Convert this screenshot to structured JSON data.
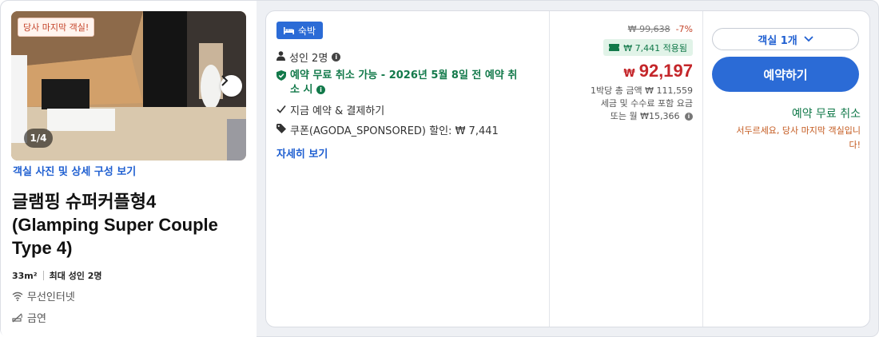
{
  "room": {
    "photo": {
      "last_room_tag": "당사 마지막 객실!",
      "counter": "1/4"
    },
    "photo_link": "객실 사진 및 상세 구성 보기",
    "title_lines": [
      "글램핑 슈퍼커플형4",
      "(Glamping Super Couple",
      "Type 4)"
    ],
    "size": "33m²",
    "max_occupancy": "최대 성인 2명",
    "amenities": [
      {
        "icon": "wifi-icon",
        "label": "무선인터넷"
      },
      {
        "icon": "no-smoking-icon",
        "label": "금연"
      }
    ]
  },
  "offer": {
    "badge": "숙박",
    "guests": "성인 2명",
    "free_cancel_line1": "예약 무료 취소 가능 - 2026년 5월 8일 전 예약 취",
    "free_cancel_line2": "소 시",
    "pay_now": "지금 예약 & 결제하기",
    "coupon": "쿠폰(AGODA_SPONSORED) 할인: ₩ 7,441",
    "more_link": "자세히 보기"
  },
  "price": {
    "original": "₩ 99,638",
    "discount_pct": "-7%",
    "applied": "₩ 7,441 적용됨",
    "currency": "₩",
    "final": "92,197",
    "note_line1": "1박당 총 금액 ₩ 111,559",
    "note_line2": "세금 및 수수료 포함 요금",
    "note_line3": "또는 월 ₩15,366"
  },
  "actions": {
    "room_select": "객실 1개",
    "book_button": "예약하기",
    "free_cancel": "예약 무료 취소",
    "hurry_line1": "서두르세요, 당사 마지막 객실입니",
    "hurry_line2": "다!"
  },
  "colors": {
    "accent_blue": "#2b6bd6",
    "link_blue": "#1f5fd1",
    "green": "#12794a",
    "price_red": "#c4262a",
    "urgency_orange": "#c45a1f"
  }
}
